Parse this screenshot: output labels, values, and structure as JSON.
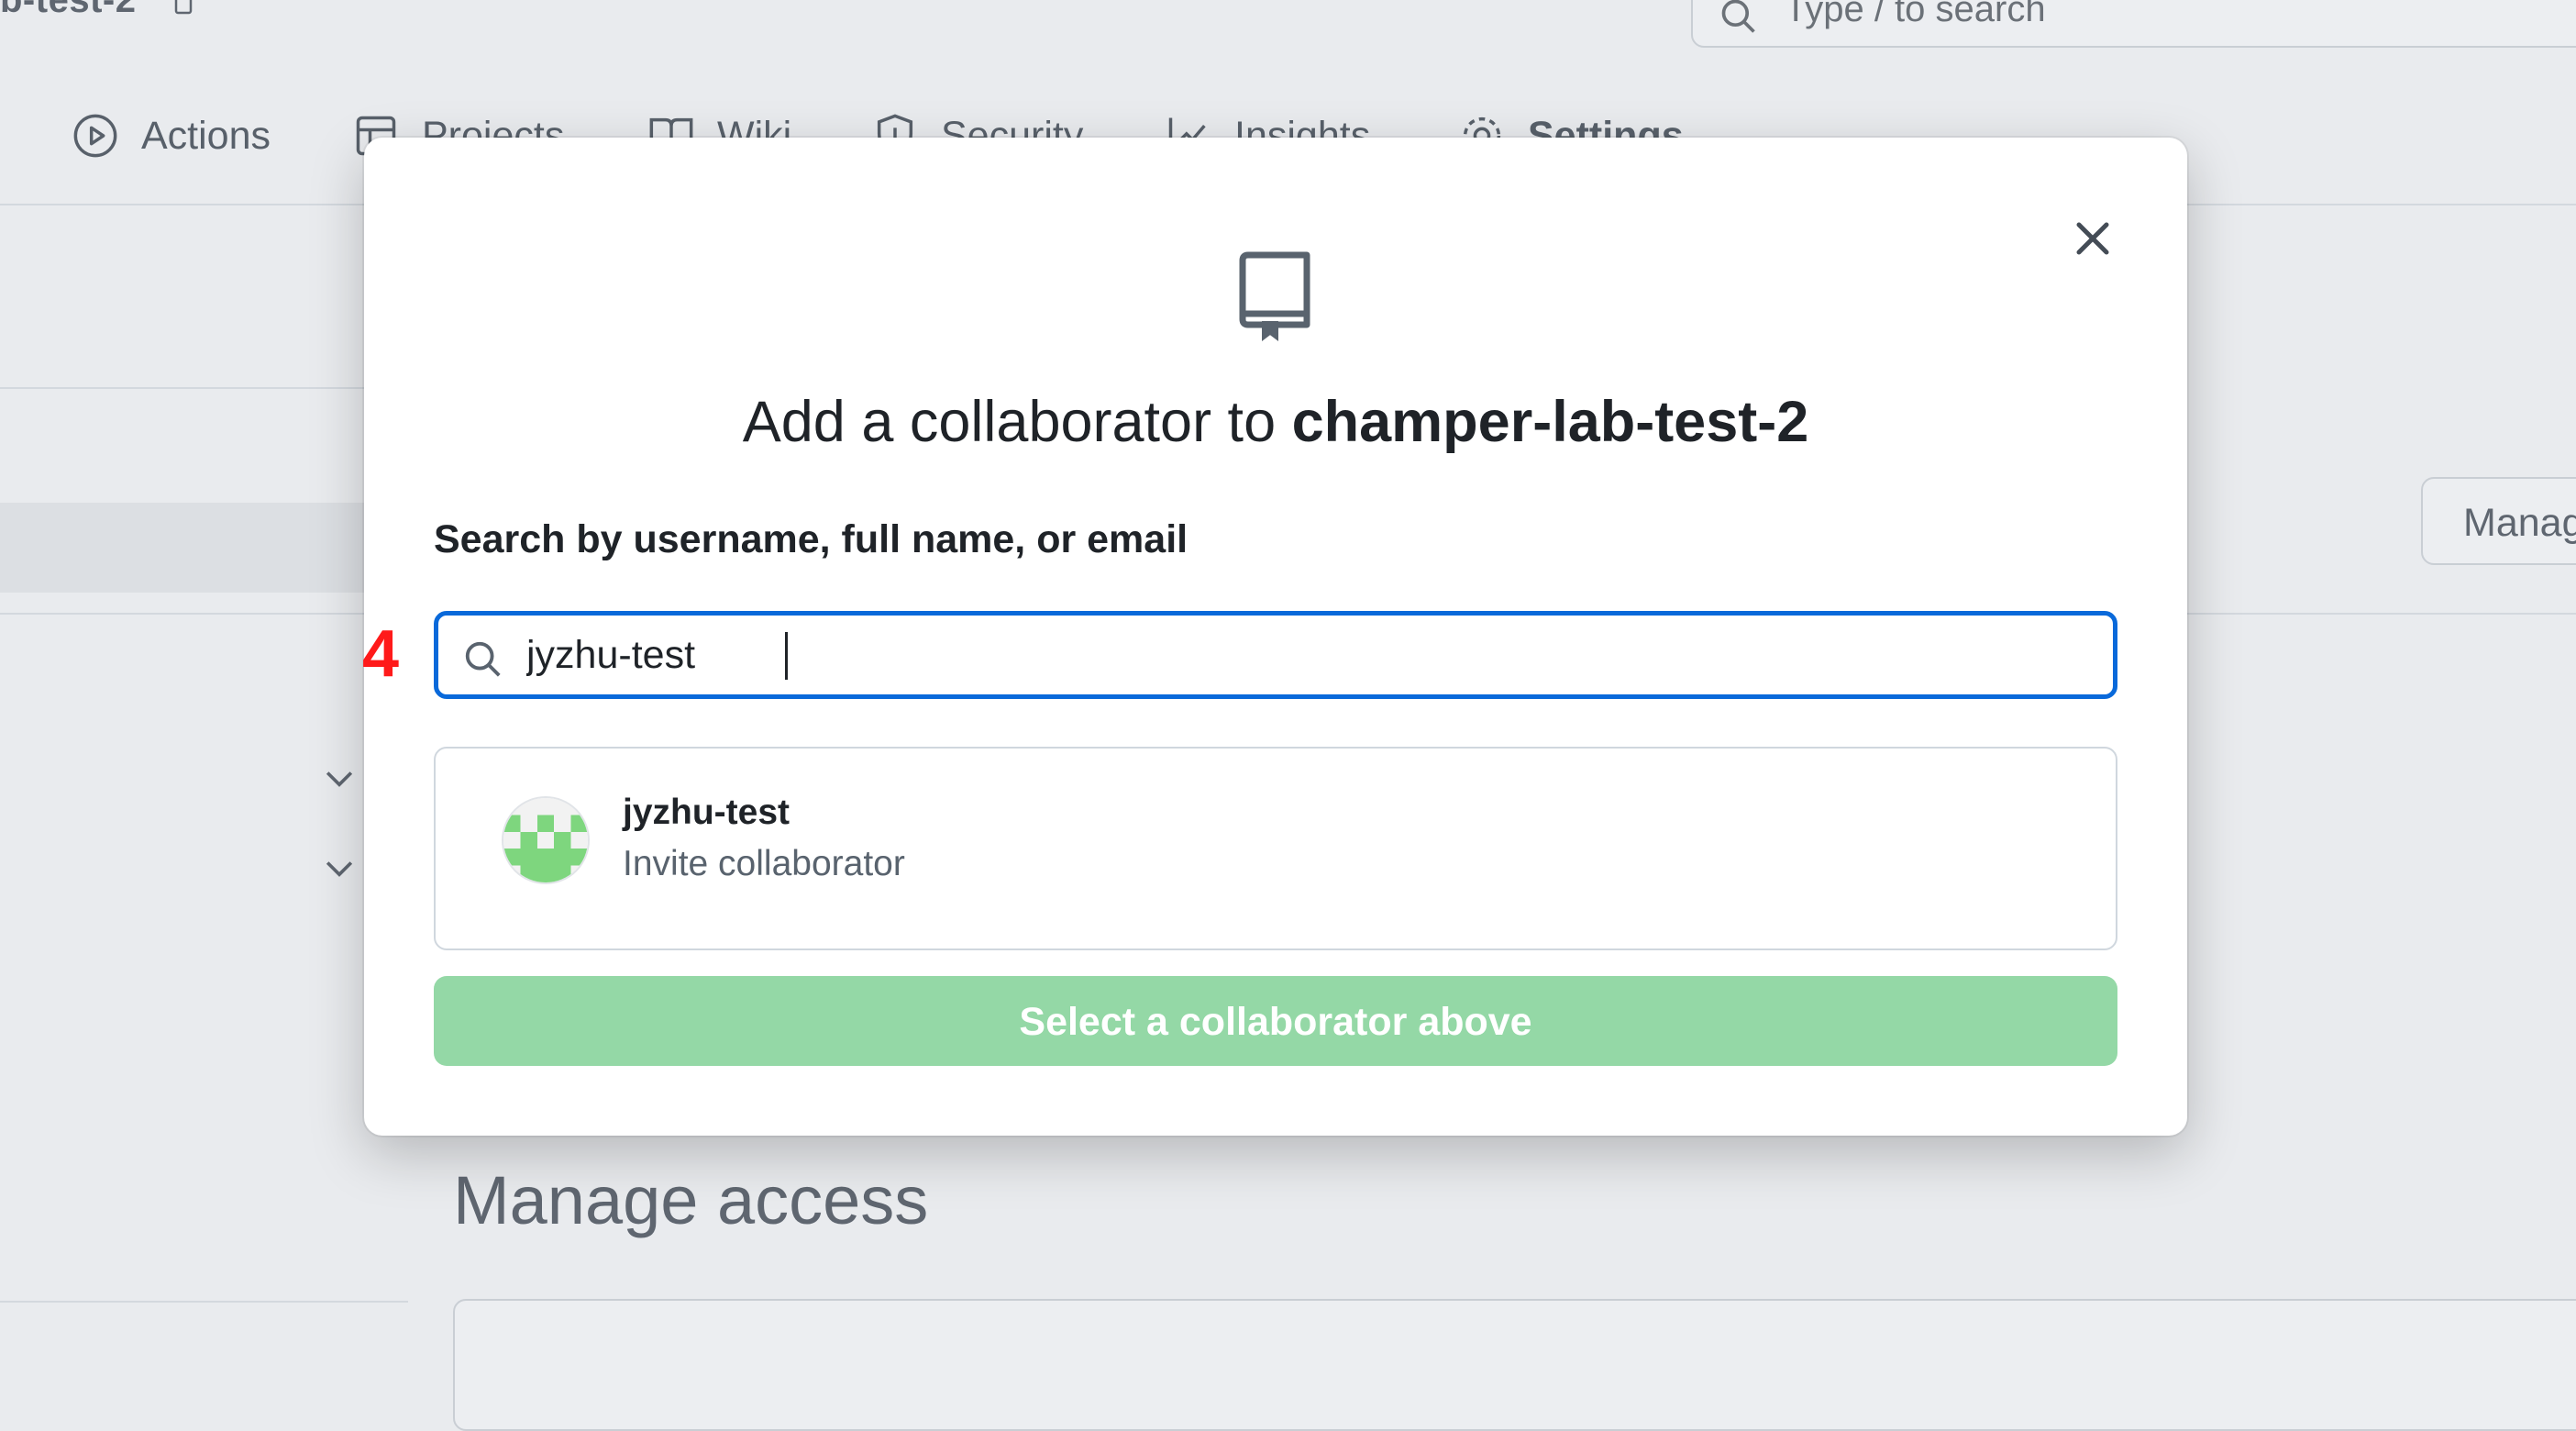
{
  "background": {
    "repo_name_fragment": "b-test-2",
    "search_placeholder": "Type / to search",
    "nav": [
      {
        "label": "Actions",
        "icon": "play-circle-icon"
      },
      {
        "label": "Projects",
        "icon": "table-icon"
      },
      {
        "label": "Wiki",
        "icon": "book-icon"
      },
      {
        "label": "Security",
        "icon": "shield-icon"
      },
      {
        "label": "Insights",
        "icon": "graph-icon"
      },
      {
        "label": "Settings",
        "icon": "gear-icon"
      }
    ],
    "manage_button_label": "Manag",
    "manage_access_heading": "Manage access"
  },
  "modal": {
    "title_prefix": "Add a collaborator to ",
    "title_repo": "champer-lab-test-2",
    "search_label": "Search by username, full name, or email",
    "search_value": "jyzhu-test",
    "results": [
      {
        "username": "jyzhu-test",
        "action": "Invite collaborator"
      }
    ],
    "submit_label": "Select a collaborator above",
    "colors": {
      "focus_border": "#0969da",
      "submit_disabled": "#94d8a6",
      "avatar_green": "#7ed67e"
    }
  },
  "step_marker": "4"
}
